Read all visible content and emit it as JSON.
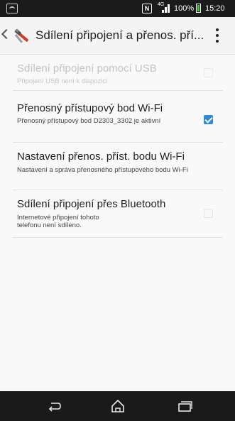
{
  "status_bar": {
    "nfc": "N",
    "network": "4G",
    "battery_percent": "100%",
    "time": "15:20"
  },
  "action_bar": {
    "title": "Sdílení připojení a přenos. pří..."
  },
  "settings": [
    {
      "title": "Sdílení připojení pomocí USB",
      "subtitle": "Připojení USB není k dispozici",
      "enabled": false,
      "checked": false
    },
    {
      "title": "Přenosný přístupový bod Wi-Fi",
      "subtitle": "Přenosný přístupový bod D2303_3302 je aktivní",
      "enabled": true,
      "checked": true
    },
    {
      "title": "Nastavení přenos. příst. bodu Wi-Fi",
      "subtitle": "Nastavení a správa přenosného přístupového bodu Wi-Fi",
      "enabled": true
    },
    {
      "title": "Sdílení připojení přes Bluetooth",
      "subtitle": "Internetové připojení tohoto telefonu není sdíleno.",
      "enabled": true,
      "checked": false
    }
  ],
  "colors": {
    "accent": "#2f8ad4",
    "battery": "#3fcf2f",
    "status_bar": "#1b1b1b",
    "nav_bar": "#1a1a1a"
  },
  "icons": {
    "app": "tools-icon",
    "back": "chevron-left-icon",
    "menu": "overflow-menu-icon",
    "nav_back": "back-icon",
    "nav_home": "home-icon",
    "nav_recents": "recent-apps-icon"
  }
}
